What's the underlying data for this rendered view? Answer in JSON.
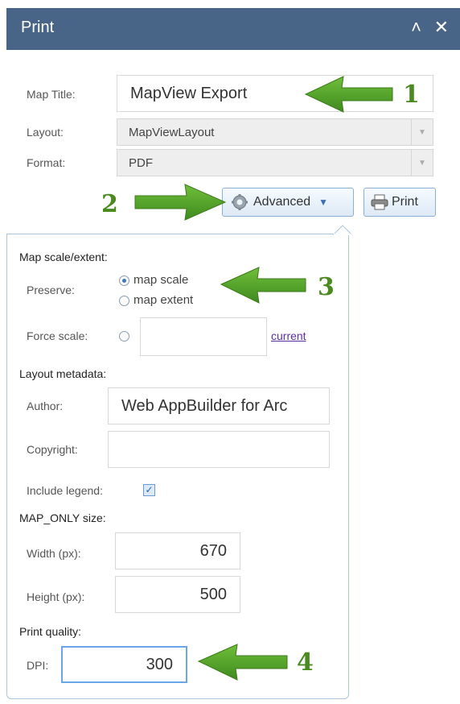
{
  "header": {
    "title": "Print",
    "collapse_icon": "chevron-double-up-icon",
    "close_icon": "close-icon"
  },
  "form": {
    "map_title_label": "Map Title:",
    "map_title_value": "MapView Export",
    "layout_label": "Layout:",
    "layout_value": "MapViewLayout",
    "format_label": "Format:",
    "format_value": "PDF"
  },
  "buttons": {
    "advanced_label": "Advanced",
    "print_label": "Print"
  },
  "advanced": {
    "scale_header": "Map scale/extent:",
    "preserve_label": "Preserve:",
    "option_map_scale": "map scale",
    "option_map_extent": "map extent",
    "force_scale_label": "Force scale:",
    "force_scale_value": "",
    "current_link": "current",
    "metadata_header": "Layout metadata:",
    "author_label": "Author:",
    "author_value": "Web AppBuilder for Arc",
    "copyright_label": "Copyright:",
    "copyright_value": "",
    "legend_label": "Include legend:",
    "mapsize_header": "MAP_ONLY size:",
    "width_label": "Width (px):",
    "width_value": "670",
    "height_label": "Height (px):",
    "height_value": "500",
    "quality_header": "Print quality:",
    "dpi_label": "DPI:",
    "dpi_value": "300"
  },
  "annotations": [
    "1",
    "2",
    "3",
    "4"
  ],
  "colors": {
    "header_bg": "#486587",
    "arrow": "#4f9a2a",
    "link": "#5b2f9e",
    "focus_border": "#6aa7e8"
  }
}
